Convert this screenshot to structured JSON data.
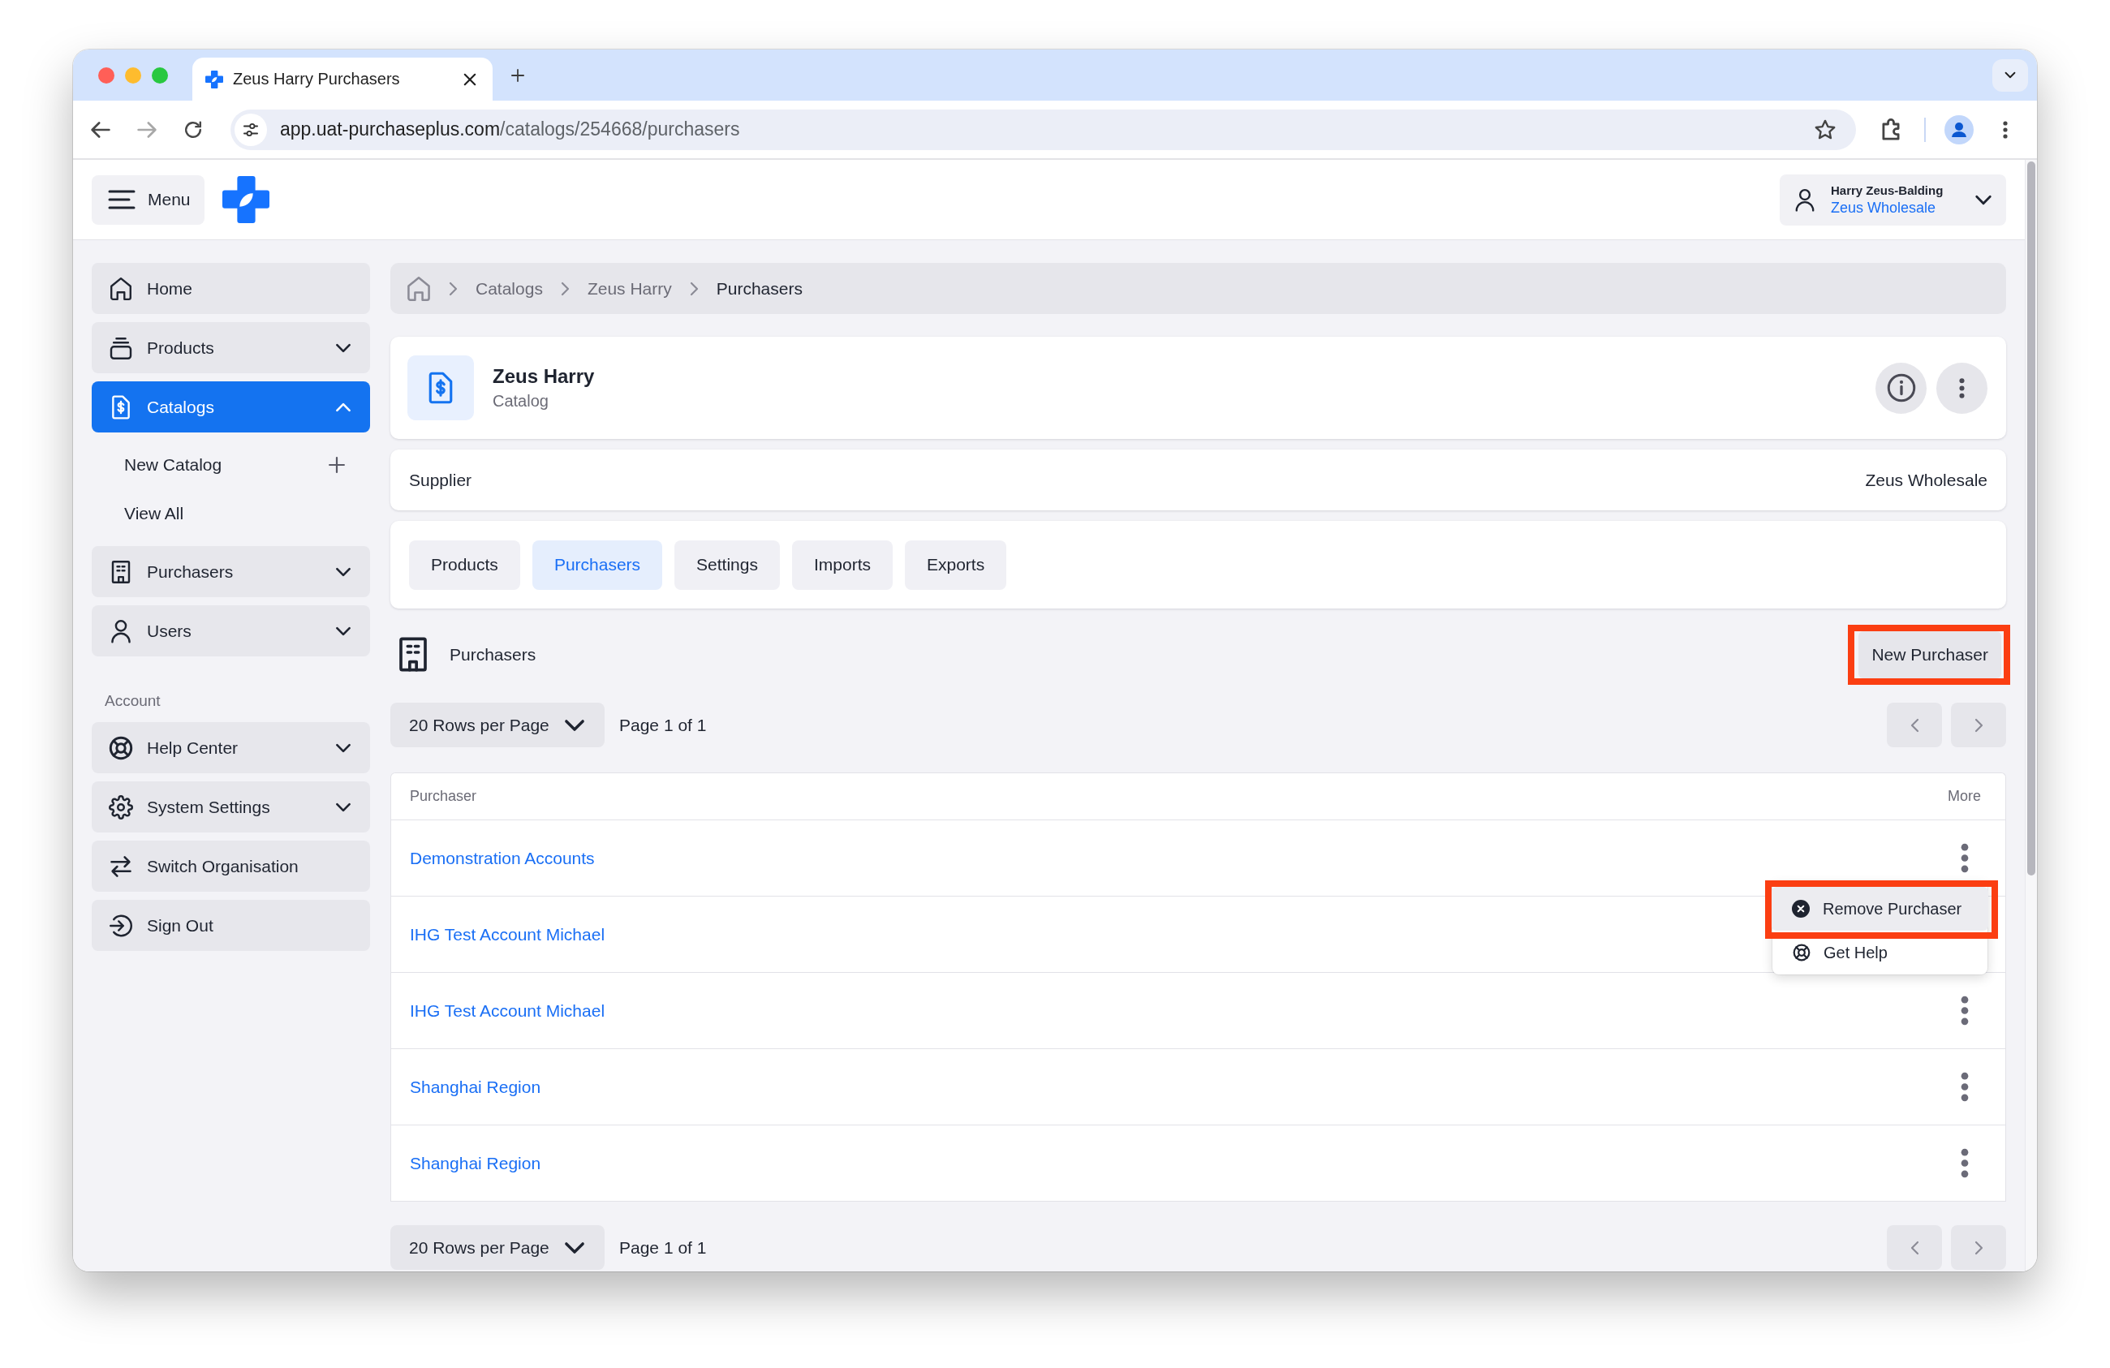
{
  "browser": {
    "tabs": [
      {
        "title": "Zeus Harry Purchasers",
        "selected": true
      }
    ],
    "url": {
      "host": "app.uat-purchaseplus.com",
      "path": "/catalogs/254668/purchasers"
    }
  },
  "header": {
    "menu_label": "Menu",
    "user": {
      "name": "Harry Zeus-Balding",
      "organisation": "Zeus Wholesale"
    }
  },
  "sidebar": {
    "sections": [
      {
        "items": [
          {
            "kind": "link",
            "label": "Home",
            "selected": false
          },
          {
            "kind": "group",
            "label": "Products",
            "selected": false,
            "expanded": false
          },
          {
            "kind": "group",
            "label": "Catalogs",
            "selected": true,
            "expanded": true,
            "children": [
              {
                "kind": "action",
                "label": "New Catalog",
                "selected": false
              },
              {
                "kind": "link",
                "label": "View All",
                "selected": false
              }
            ]
          },
          {
            "kind": "group",
            "label": "Purchasers",
            "selected": false,
            "expanded": false
          },
          {
            "kind": "group",
            "label": "Users",
            "selected": false,
            "expanded": false
          }
        ]
      },
      {
        "title": "Account",
        "items": [
          {
            "kind": "group",
            "label": "Help Center",
            "selected": false,
            "expanded": false
          },
          {
            "kind": "group",
            "label": "System Settings",
            "selected": false,
            "expanded": false
          },
          {
            "kind": "link",
            "label": "Switch Organisation",
            "selected": false
          },
          {
            "kind": "link",
            "label": "Sign Out",
            "selected": false
          }
        ]
      }
    ]
  },
  "breadcrumb": [
    {
      "label": "Catalogs",
      "current": false
    },
    {
      "label": "Zeus Harry",
      "current": false
    },
    {
      "label": "Purchasers",
      "current": true
    }
  ],
  "record": {
    "title": "Zeus Harry",
    "subtitle": "Catalog"
  },
  "details": [
    {
      "label": "Supplier",
      "value": "Zeus Wholesale"
    }
  ],
  "tabs": [
    {
      "label": "Products",
      "selected": false
    },
    {
      "label": "Purchasers",
      "selected": true
    },
    {
      "label": "Settings",
      "selected": false
    },
    {
      "label": "Imports",
      "selected": false
    },
    {
      "label": "Exports",
      "selected": false
    }
  ],
  "section": {
    "title": "Purchasers",
    "action": {
      "label": "New Purchaser",
      "annotated": true
    }
  },
  "pagination_top": {
    "rows_per_page": "20 Rows per Page",
    "page": "Page 1 of 1"
  },
  "table": {
    "columns": [
      "Purchaser",
      "More"
    ],
    "rows": [
      {
        "purchaser": "Demonstration Accounts",
        "menu_open": true
      },
      {
        "purchaser": "IHG Test Account Michael",
        "menu_open": false
      },
      {
        "purchaser": "IHG Test Account Michael",
        "menu_open": false
      },
      {
        "purchaser": "Shanghai Region",
        "menu_open": false
      },
      {
        "purchaser": "Shanghai Region",
        "menu_open": false
      }
    ],
    "row_menu": {
      "items": [
        {
          "label": "Remove Purchaser",
          "hovered": true,
          "annotated": true
        },
        {
          "label": "Get Help",
          "hovered": false,
          "annotated": false
        }
      ]
    }
  },
  "pagination_bottom": {
    "rows_per_page": "20 Rows per Page",
    "page": "Page 1 of 1"
  }
}
